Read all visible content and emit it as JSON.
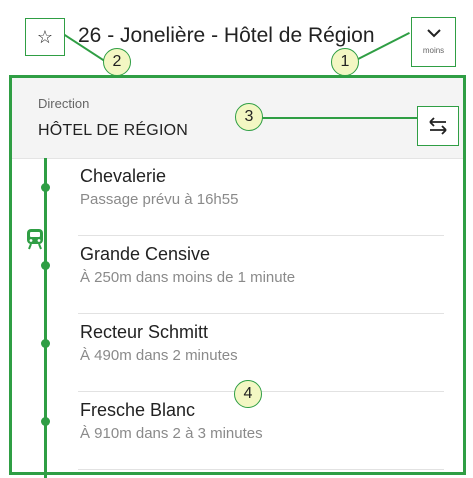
{
  "header": {
    "favorite_icon": "star-outline-icon",
    "favorite_glyph": "☆",
    "line_title": "26 - Jonelière - Hôtel de Région",
    "toggle_chevron": "⌄",
    "toggle_label": "moins"
  },
  "direction": {
    "label": "Direction",
    "value": "HÔTEL DE RÉGION",
    "swap_icon": "swap-direction-icon"
  },
  "vehicle_icon": "bus-icon",
  "stops": [
    {
      "name": "Chevalerie",
      "info": "Passage prévu à 16h55"
    },
    {
      "name": "Grande Censive",
      "info": "À 250m dans moins de 1 minute"
    },
    {
      "name": "Recteur Schmitt",
      "info": "À 490m dans 2 minutes"
    },
    {
      "name": "Fresche Blanc",
      "info": "À 910m dans 2 à 3 minutes"
    }
  ],
  "callouts": [
    "1",
    "2",
    "3",
    "4"
  ],
  "colors": {
    "accent": "#2f9e44",
    "callout_fill": "#f3f7c3",
    "header_bg": "#f4f4f4",
    "secondary_text": "#8a8a8a"
  }
}
